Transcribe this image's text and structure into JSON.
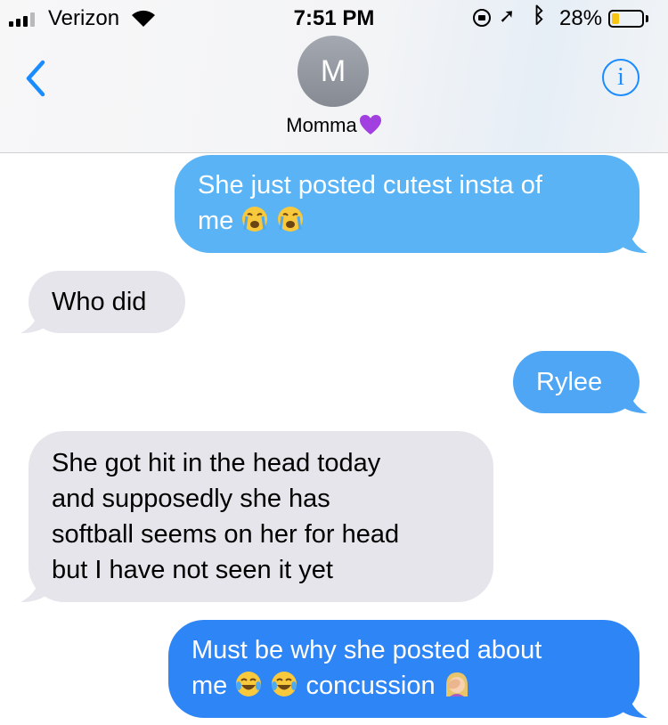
{
  "status_bar": {
    "carrier": "Verizon",
    "time": "7:51 PM",
    "battery_percent": "28%",
    "battery_level": 0.28,
    "icons": [
      "signal-icon",
      "wifi-icon",
      "rotation-lock-icon",
      "location-icon",
      "bluetooth-icon",
      "battery-icon"
    ]
  },
  "header": {
    "avatar_initial": "M",
    "contact_name": "Momma",
    "name_emoji": "purple-heart-icon",
    "back_icon": "chevron-left-icon",
    "info_label": "i"
  },
  "colors": {
    "accent": "#1a8cff",
    "sent_bubble_1": "#59b3f5",
    "sent_bubble_2": "#4ea6f5",
    "sent_bubble_3": "#2e85f5",
    "received_bubble": "#e6e5eb"
  },
  "messages": [
    {
      "direction": "sent",
      "lines": [
        "She just posted cutest insta of",
        "me"
      ],
      "emojis": [
        "crying-face-icon",
        "crying-face-icon"
      ]
    },
    {
      "direction": "received",
      "lines": [
        "Who did"
      ]
    },
    {
      "direction": "sent",
      "lines": [
        "Rylee"
      ]
    },
    {
      "direction": "received",
      "lines": [
        "She got hit in the head today",
        "and supposedly she has",
        "softball seems on her for head",
        "but I have not seen it yet"
      ]
    },
    {
      "direction": "sent",
      "lines": [
        "Must be why she posted about",
        "me",
        "concussion"
      ],
      "emojis": [
        "tears-of-joy-icon",
        "tears-of-joy-icon",
        "facepalm-icon"
      ]
    }
  ]
}
